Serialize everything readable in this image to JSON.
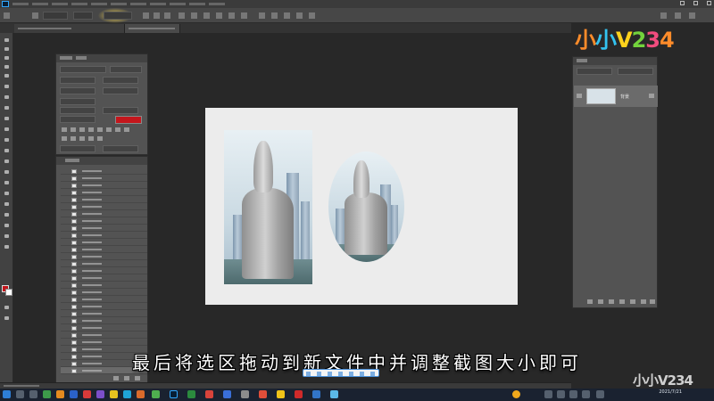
{
  "subtitle": "最后将选区拖动到新文件中并调整截图大小即可",
  "watermark": {
    "brand": "小小V234"
  },
  "colors": {
    "foreground": "#c4161c",
    "background": "#ffffff",
    "accent": "#31a8ff"
  },
  "layers_panel": {
    "layer_name": "背景"
  },
  "tip_bar": {
    "icons": [
      "pen-icon",
      "crop-icon",
      "tick-icon",
      "undo-icon",
      "copy-icon",
      "save-icon",
      "close-icon"
    ]
  },
  "taskbar": {
    "time": "",
    "date": "2021/7/21"
  },
  "toolbar": {
    "icons": [
      "move-icon",
      "marquee-icon",
      "lasso-icon",
      "quick-select-icon",
      "crop-icon",
      "eyedropper-icon",
      "healing-icon",
      "brush-icon",
      "clone-stamp-icon",
      "history-brush-icon",
      "eraser-icon",
      "gradient-icon",
      "blur-icon",
      "dodge-icon",
      "pen-icon",
      "type-icon",
      "path-select-icon",
      "shape-icon",
      "hand-icon",
      "zoom-icon"
    ]
  }
}
